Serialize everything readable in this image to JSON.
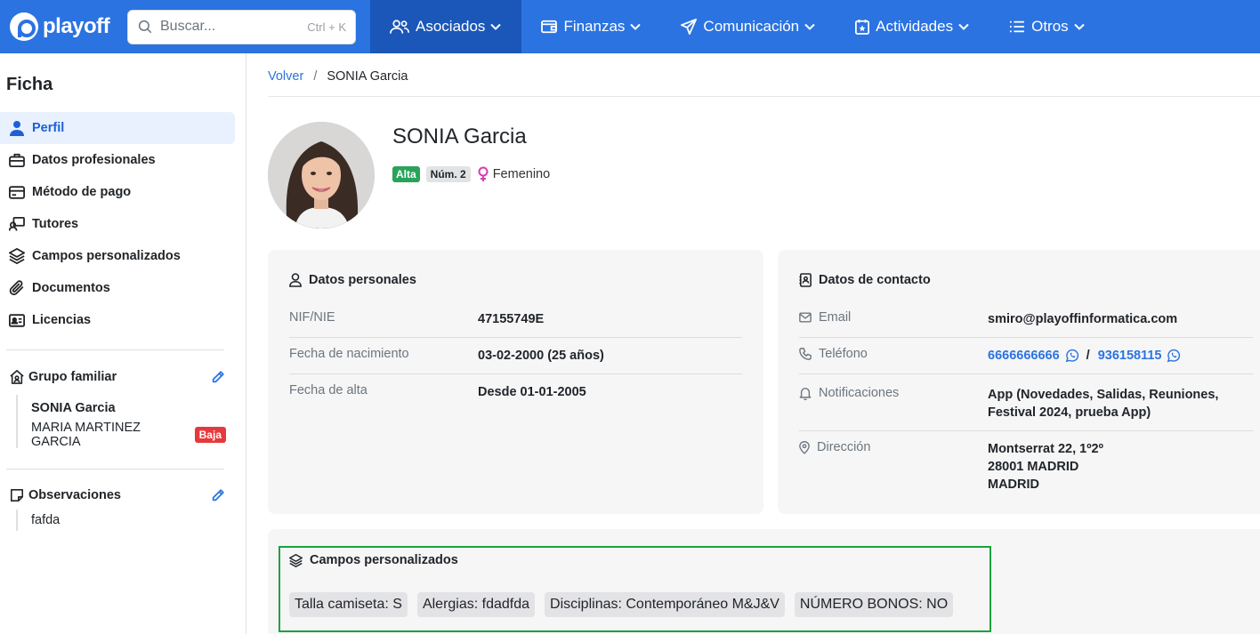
{
  "navbar": {
    "logo_text": "playoff",
    "search_placeholder": "Buscar...",
    "search_shortcut": "Ctrl + K",
    "items": [
      {
        "label": "Asociados",
        "icon": "users-icon",
        "active": true
      },
      {
        "label": "Finanzas",
        "icon": "wallet-icon",
        "active": false
      },
      {
        "label": "Comunicación",
        "icon": "send-icon",
        "active": false
      },
      {
        "label": "Actividades",
        "icon": "calendar-star-icon",
        "active": false
      },
      {
        "label": "Otros",
        "icon": "list-icon",
        "active": false
      }
    ]
  },
  "sidebar": {
    "title": "Ficha",
    "items": [
      {
        "label": "Perfil",
        "icon": "user-icon",
        "active": true
      },
      {
        "label": "Datos profesionales",
        "icon": "briefcase-icon"
      },
      {
        "label": "Método de pago",
        "icon": "credit-card-icon"
      },
      {
        "label": "Tutores",
        "icon": "tutor-icon"
      },
      {
        "label": "Campos personalizados",
        "icon": "layers-icon"
      },
      {
        "label": "Documentos",
        "icon": "paperclip-icon"
      },
      {
        "label": "Licencias",
        "icon": "id-card-icon"
      }
    ],
    "family": {
      "title": "Grupo familiar",
      "members": [
        {
          "name": "SONIA Garcia",
          "bold": true,
          "badge": ""
        },
        {
          "name": "MARIA MARTINEZ GARCIA",
          "bold": false,
          "badge": "Baja"
        }
      ]
    },
    "observations": {
      "title": "Observaciones",
      "text": "fafda"
    }
  },
  "breadcrumb": {
    "back": "Volver",
    "separator": "/",
    "current": "SONIA Garcia"
  },
  "profile": {
    "name": "SONIA Garcia",
    "status_badge": "Alta",
    "number_badge": "Núm. 2",
    "gender": "Femenino"
  },
  "personal": {
    "title": "Datos personales",
    "rows": [
      {
        "label": "NIF/NIE",
        "value": "47155749E"
      },
      {
        "label": "Fecha de nacimiento",
        "value": "03-02-2000 (25 años)"
      },
      {
        "label": "Fecha de alta",
        "value": "Desde 01-01-2005"
      }
    ]
  },
  "contact": {
    "title": "Datos de contacto",
    "email_label": "Email",
    "email": "smiro@playoffinformatica.com",
    "phone_label": "Teléfono",
    "phone1": "6666666666",
    "phone_separator": "/",
    "phone2": "936158115",
    "notif_label": "Notificaciones",
    "notif_line1": "App (Novedades, Salidas, Reuniones,",
    "notif_line2": "Festival 2024, prueba App)",
    "address_label": "Dirección",
    "address_line1": "Montserrat 22, 1º2º",
    "address_line2": "28001 MADRID",
    "address_line3": "MADRID"
  },
  "custom_fields": {
    "title": "Campos personalizados",
    "chips": [
      "Talla camiseta: S",
      "Alergias: fdadfda",
      "Disciplinas: Contemporáneo M&J&V",
      "NÚMERO BONOS: NO"
    ]
  },
  "colors": {
    "brand": "#2b73e0",
    "nav_active": "#1a57b8",
    "success": "#29a35a",
    "danger": "#e5393b",
    "highlight_border": "#1aa33c"
  }
}
